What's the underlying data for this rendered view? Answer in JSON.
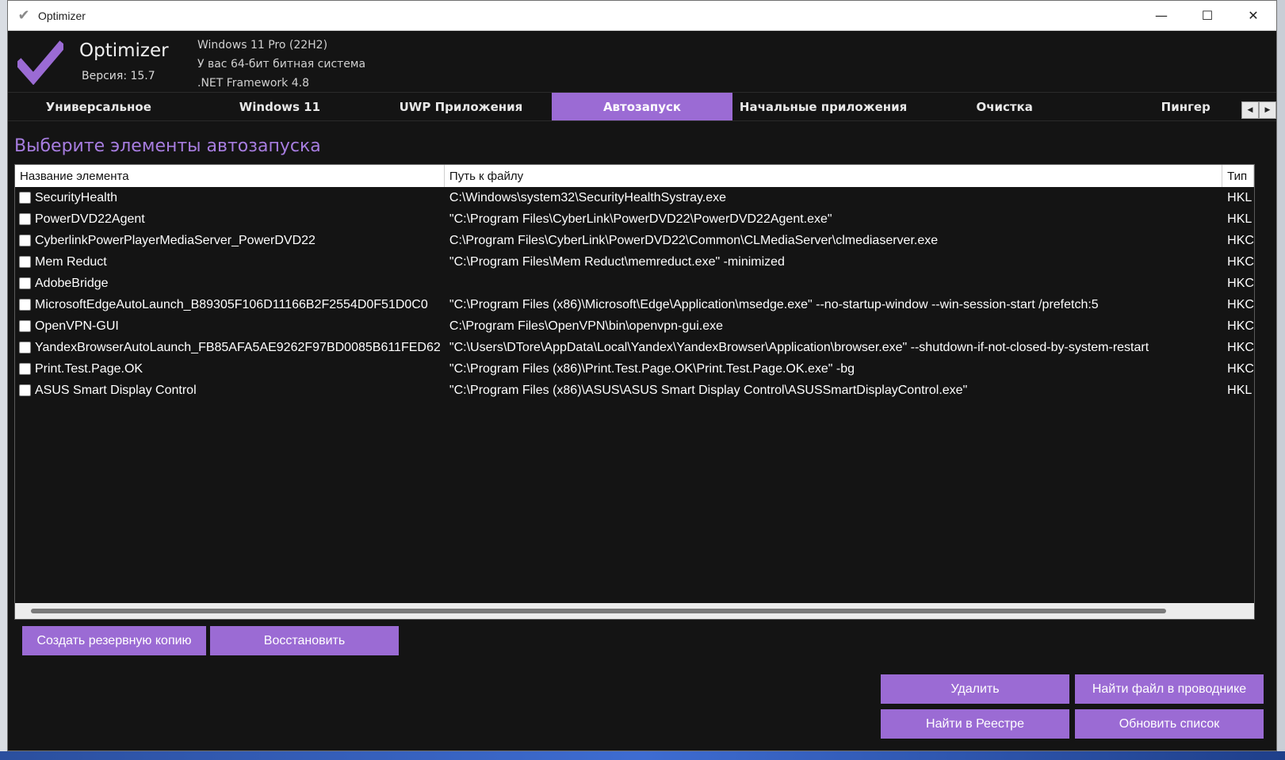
{
  "window": {
    "title": "Optimizer"
  },
  "header": {
    "app_name": "Optimizer",
    "version": "Версия: 15.7",
    "os": "Windows 11 Pro (22H2)",
    "arch": "У вас 64-бит битная система",
    "framework": ".NET Framework 4.8"
  },
  "tabs": [
    {
      "label": "Универсальное"
    },
    {
      "label": "Windows 11"
    },
    {
      "label": "UWP Приложения"
    },
    {
      "label": "Автозапуск",
      "active": true
    },
    {
      "label": "Начальные приложения"
    },
    {
      "label": "Очистка"
    },
    {
      "label": "Пингер"
    }
  ],
  "main": {
    "title": "Выберите элементы автозапуска",
    "columns": {
      "name": "Название элемента",
      "path": "Путь к файлу",
      "type": "Тип"
    },
    "rows": [
      {
        "name": "SecurityHealth",
        "path": "C:\\Windows\\system32\\SecurityHealthSystray.exe",
        "type": "HKL"
      },
      {
        "name": "PowerDVD22Agent",
        "path": "\"C:\\Program Files\\CyberLink\\PowerDVD22\\PowerDVD22Agent.exe\"",
        "type": "HKL"
      },
      {
        "name": "CyberlinkPowerPlayerMediaServer_PowerDVD22",
        "path": "C:\\Program Files\\CyberLink\\PowerDVD22\\Common\\CLMediaServer\\clmediaserver.exe",
        "type": "HKC"
      },
      {
        "name": "Mem Reduct",
        "path": "\"C:\\Program Files\\Mem Reduct\\memreduct.exe\" -minimized",
        "type": "HKC"
      },
      {
        "name": "AdobeBridge",
        "path": "",
        "type": "HKC"
      },
      {
        "name": "MicrosoftEdgeAutoLaunch_B89305F106D11166B2F2554D0F51D0C0",
        "path": "\"C:\\Program Files (x86)\\Microsoft\\Edge\\Application\\msedge.exe\" --no-startup-window --win-session-start /prefetch:5",
        "type": "HKC"
      },
      {
        "name": "OpenVPN-GUI",
        "path": "C:\\Program Files\\OpenVPN\\bin\\openvpn-gui.exe",
        "type": "HKC"
      },
      {
        "name": "YandexBrowserAutoLaunch_FB85AFA5AE9262F97BD0085B611FED62",
        "path": "\"C:\\Users\\DTore\\AppData\\Local\\Yandex\\YandexBrowser\\Application\\browser.exe\" --shutdown-if-not-closed-by-system-restart",
        "type": "HKC"
      },
      {
        "name": "Print.Test.Page.OK",
        "path": "\"C:\\Program Files (x86)\\Print.Test.Page.OK\\Print.Test.Page.OK.exe\" -bg",
        "type": "HKC"
      },
      {
        "name": "ASUS Smart Display Control",
        "path": "\"C:\\Program Files (x86)\\ASUS\\ASUS Smart Display Control\\ASUSSmartDisplayControl.exe\"",
        "type": "HKL"
      }
    ]
  },
  "buttons": {
    "backup": "Создать резервную копию",
    "restore": "Восстановить",
    "delete": "Удалить",
    "find_explorer": "Найти файл в проводнике",
    "find_registry": "Найти в Реестре",
    "refresh": "Обновить список"
  },
  "colors": {
    "accent": "#9b6bd4",
    "title": "#a77de0",
    "background": "#141414"
  }
}
